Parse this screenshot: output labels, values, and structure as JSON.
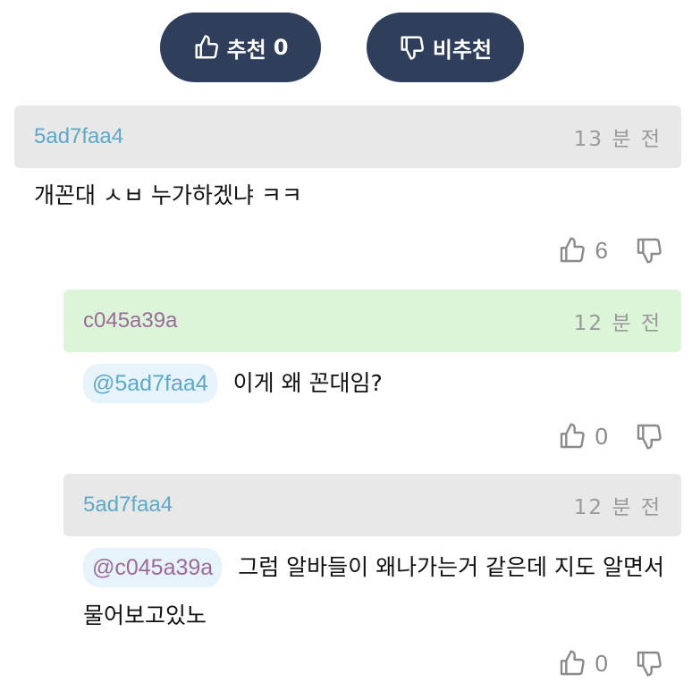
{
  "vote": {
    "recommend_label": "추천",
    "recommend_count": "0",
    "not_recommend_label": "비추천"
  },
  "comments": [
    {
      "author": "5ad7faa4",
      "time": "13 분 전",
      "text": "개꼰대 ㅅㅂ 누가하겠냐 ㅋㅋ",
      "likes": "6"
    },
    {
      "author": "c045a39a",
      "time": "12 분 전",
      "mention": "@5ad7faa4",
      "text": "이게 왜 꼰대임?",
      "likes": "0"
    },
    {
      "author": "5ad7faa4",
      "time": "12 분 전",
      "mention": "@c045a39a",
      "text": "그럼 알바들이 왜나가는거 같은데 지도 알면서 물어보고있노",
      "likes": "0"
    }
  ],
  "colors": {
    "vote_button_bg": "#2f3e5b",
    "header_gray": "#e8e8e8",
    "header_green": "#dcf4d8",
    "author_blue": "#5fa8c8",
    "author_purple": "#9b6b99"
  },
  "icons": {
    "like": "thumbs-up-icon",
    "dislike": "thumbs-down-icon"
  }
}
